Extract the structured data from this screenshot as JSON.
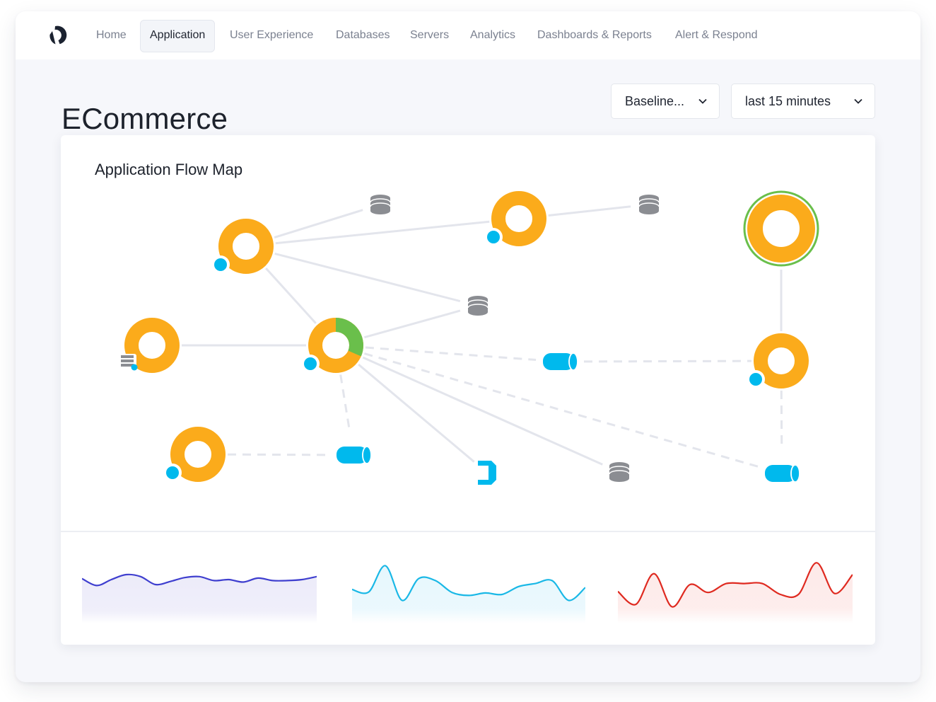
{
  "nav": {
    "logo": "brand-logo",
    "items": [
      {
        "label": "Home",
        "active": false
      },
      {
        "label": "Application",
        "active": true
      },
      {
        "label": "User Experience",
        "active": false
      },
      {
        "label": "Databases",
        "active": false
      },
      {
        "label": "Servers",
        "active": false
      },
      {
        "label": "Analytics",
        "active": false
      },
      {
        "label": "Dashboards & Reports",
        "active": false
      },
      {
        "label": "Alert & Respond",
        "active": false
      }
    ]
  },
  "page": {
    "title": "ECommerce",
    "baseline_select": {
      "value": "Baseline...",
      "icon": "chevron-down-icon"
    },
    "time_select": {
      "value": "last 15 minutes",
      "icon": "chevron-down-icon"
    }
  },
  "flow_map": {
    "title": "Application Flow Map",
    "colors": {
      "tier": "#fbab1b",
      "healthy": "#6abf4b",
      "agent": "#00b9ed",
      "database": "#8b8d92",
      "edge": "#e3e5ec"
    },
    "nodes": [
      {
        "id": "tier-a",
        "type": "tier",
        "health_fraction": 0,
        "agent": true
      },
      {
        "id": "tier-b",
        "type": "tier",
        "health_fraction": 0,
        "agent": true
      },
      {
        "id": "tier-c",
        "type": "tier",
        "health_fraction": 0,
        "agent": false,
        "badge": "list-icon",
        "status": "selected"
      },
      {
        "id": "tier-d",
        "type": "tier",
        "health_fraction": 0.3,
        "agent": true
      },
      {
        "id": "tier-e",
        "type": "tier",
        "health_fraction": 0,
        "agent": true
      },
      {
        "id": "tier-f",
        "type": "tier",
        "health_fraction": 0,
        "agent": false,
        "badge": "list-icon"
      },
      {
        "id": "tier-g",
        "type": "tier",
        "health_fraction": 0,
        "agent": true
      },
      {
        "id": "tier-h",
        "type": "tier",
        "health_fraction": 0,
        "agent": true
      },
      {
        "id": "db-1",
        "type": "database"
      },
      {
        "id": "db-2",
        "type": "database"
      },
      {
        "id": "db-3",
        "type": "database"
      },
      {
        "id": "db-4",
        "type": "database"
      },
      {
        "id": "queue-1",
        "type": "queue"
      },
      {
        "id": "queue-2",
        "type": "queue"
      },
      {
        "id": "queue-3",
        "type": "queue"
      },
      {
        "id": "remote-1",
        "type": "remote-service"
      }
    ],
    "edges": [
      {
        "from": "tier-a",
        "to": "db-1",
        "style": "solid"
      },
      {
        "from": "tier-a",
        "to": "tier-b",
        "style": "solid"
      },
      {
        "from": "tier-a",
        "to": "db-3",
        "style": "solid"
      },
      {
        "from": "tier-a",
        "to": "tier-d",
        "style": "solid"
      },
      {
        "from": "tier-b",
        "to": "db-2",
        "style": "solid"
      },
      {
        "from": "tier-f",
        "to": "tier-d",
        "style": "solid"
      },
      {
        "from": "tier-d",
        "to": "db-3",
        "style": "solid"
      },
      {
        "from": "tier-d",
        "to": "queue-1",
        "style": "dashed"
      },
      {
        "from": "tier-d",
        "to": "queue-3",
        "style": "dashed"
      },
      {
        "from": "tier-d",
        "to": "db-4",
        "style": "solid"
      },
      {
        "from": "tier-d",
        "to": "remote-1",
        "style": "solid"
      },
      {
        "from": "tier-d",
        "to": "queue-2",
        "style": "dashed"
      },
      {
        "from": "tier-g",
        "to": "queue-2",
        "style": "dashed"
      },
      {
        "from": "queue-1",
        "to": "tier-h",
        "style": "dashed"
      },
      {
        "from": "tier-c",
        "to": "tier-h",
        "style": "solid"
      },
      {
        "from": "tier-h",
        "to": "queue-3",
        "style": "dashed"
      }
    ]
  },
  "sparklines": [
    {
      "name": "load",
      "color": "#3f3fcf",
      "fill": "#ecebf9",
      "values": [
        0.62,
        0.48,
        0.6,
        0.7,
        0.66,
        0.5,
        0.56,
        0.64,
        0.66,
        0.58,
        0.6,
        0.55,
        0.63,
        0.58,
        0.58,
        0.6,
        0.66
      ]
    },
    {
      "name": "response-time",
      "color": "#1ab8e6",
      "fill": "#e6f7fd",
      "values": [
        0.4,
        0.35,
        0.88,
        0.18,
        0.62,
        0.58,
        0.34,
        0.28,
        0.33,
        0.3,
        0.46,
        0.52,
        0.58,
        0.18,
        0.44
      ]
    },
    {
      "name": "errors",
      "color": "#df2a20",
      "fill": "#fde9e8",
      "values": [
        0.36,
        0.1,
        0.72,
        0.05,
        0.5,
        0.34,
        0.52,
        0.52,
        0.52,
        0.3,
        0.3,
        0.94,
        0.32,
        0.7
      ]
    }
  ]
}
